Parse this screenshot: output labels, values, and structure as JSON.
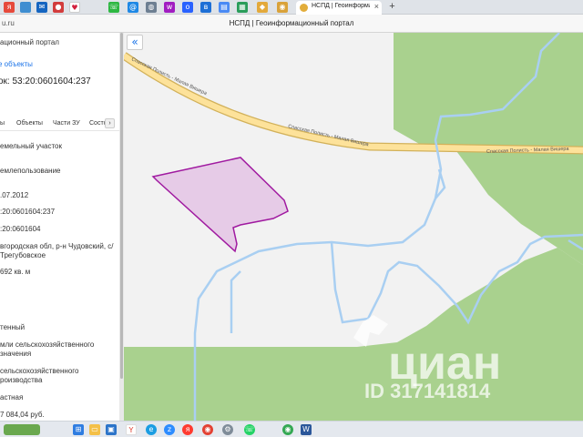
{
  "browser": {
    "url_text": "u.ru",
    "page_title": "НСПД | Геоинформационный портал",
    "active_tab_label": "НСПД | Геоинформаци",
    "close_label": "×",
    "new_tab_label": "+"
  },
  "panel": {
    "header_title": "ационный портал",
    "back_link": "е объекты",
    "parcel_title": "ок: 53:20:0601604:237",
    "tabs": [
      "ы",
      "Объекты",
      "Части ЗУ",
      "Состо"
    ],
    "tabs_arrow": "›",
    "fields": [
      [
        "емельный участок"
      ],
      [
        "емлепользование"
      ],
      [
        ".07.2012"
      ],
      [
        ":20:0601604:237"
      ],
      [
        ":20:0601604"
      ],
      [
        "вгородская обл, р-н Чудовский, с/",
        "Трегубовское"
      ],
      [
        "692 кв. м"
      ],
      [
        "тенный"
      ],
      [
        "мли сельскохозяйственного",
        "значения"
      ],
      [
        "сельскохозяйственного",
        "роизводства"
      ],
      [
        "астная"
      ],
      [
        "7 084,04 руб."
      ]
    ]
  },
  "map": {
    "collapse_button": "«",
    "road_labels": [
      "Спасская Полисть - Малая Вишера",
      "Спасская Полисть - Малая Вишера",
      "Спасская Полисть - Малая Вишера"
    ],
    "watermark_brand": "циан",
    "watermark_id": "ID 317141814",
    "colors": {
      "forest": "#a9d18e",
      "background": "#f2f2f2",
      "road_fill": "#fde29a",
      "road_edge": "#d2b15a",
      "stream": "#a9cff2",
      "parcel_fill": "#e4c6e6",
      "parcel_edge": "#a01aa0"
    }
  },
  "taskbar": {
    "icons": [
      "windows-logo",
      "file-explorer",
      "microsoft-store",
      "yandex-browser",
      "edge-browser",
      "zoom",
      "yandex-music",
      "chrome",
      "settings",
      "whatsapp",
      "chrome-2",
      "word"
    ]
  }
}
